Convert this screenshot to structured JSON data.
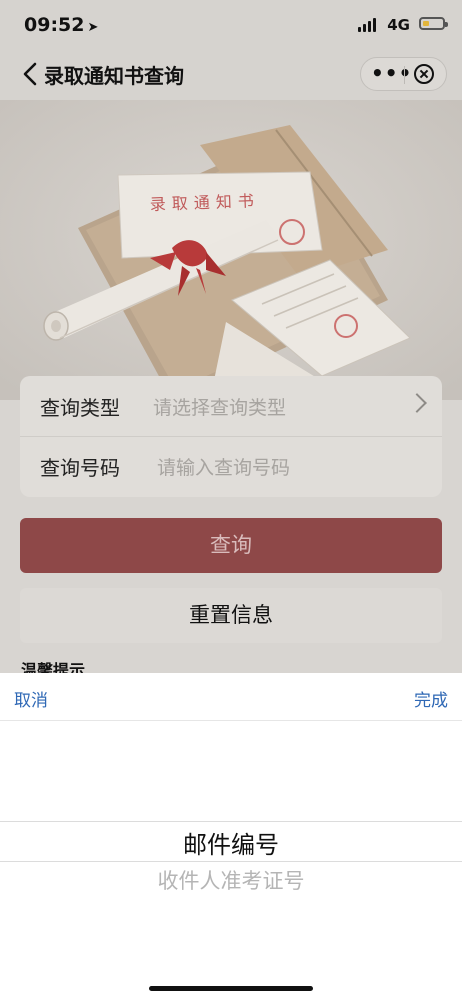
{
  "status_bar": {
    "time": "09:52",
    "network": "4G"
  },
  "nav": {
    "title": "录取通知书查询"
  },
  "hero": {
    "letter_text": "录取通知书"
  },
  "form": {
    "type_label": "查询类型",
    "type_placeholder": "请选择查询类型",
    "number_label": "查询号码",
    "number_placeholder": "请输入查询号码"
  },
  "buttons": {
    "query": "查询",
    "reset": "重置信息"
  },
  "tip": {
    "label": "温馨提示"
  },
  "picker": {
    "cancel": "取消",
    "done": "完成",
    "options": [
      "邮件编号",
      "收件人准考证号"
    ],
    "selected": "邮件编号"
  },
  "colors": {
    "accent": "#8e4848",
    "picker_link": "#2f68b5"
  }
}
